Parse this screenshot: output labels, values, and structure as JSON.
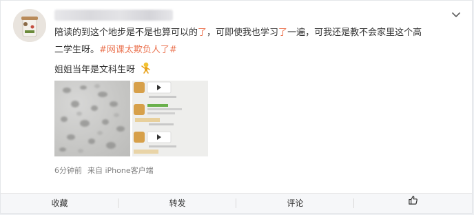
{
  "post": {
    "line1_a": "陪读的到这个地步是不是也算可以的",
    "line1_hl1": "了",
    "line1_b": "，可即使我也学习",
    "line1_hl2": "了",
    "line1_c": "一遍，可我还是教不会家里这个高",
    "line2_a": "二学生呀。",
    "hashtag": "#网课太欺负人了#",
    "line3": "姐姐当年是文科生呀",
    "emoji_icon": "thinking-figure-icon"
  },
  "meta": {
    "time": "6分钟前",
    "source": "来自 iPhone客户端"
  },
  "actions": {
    "favorite": "收藏",
    "repost": "转发",
    "comment": "评论",
    "like_icon": "thumbs-up-icon"
  },
  "colors": {
    "accent": "#eb7350",
    "text": "#333333",
    "meta": "#808080"
  }
}
